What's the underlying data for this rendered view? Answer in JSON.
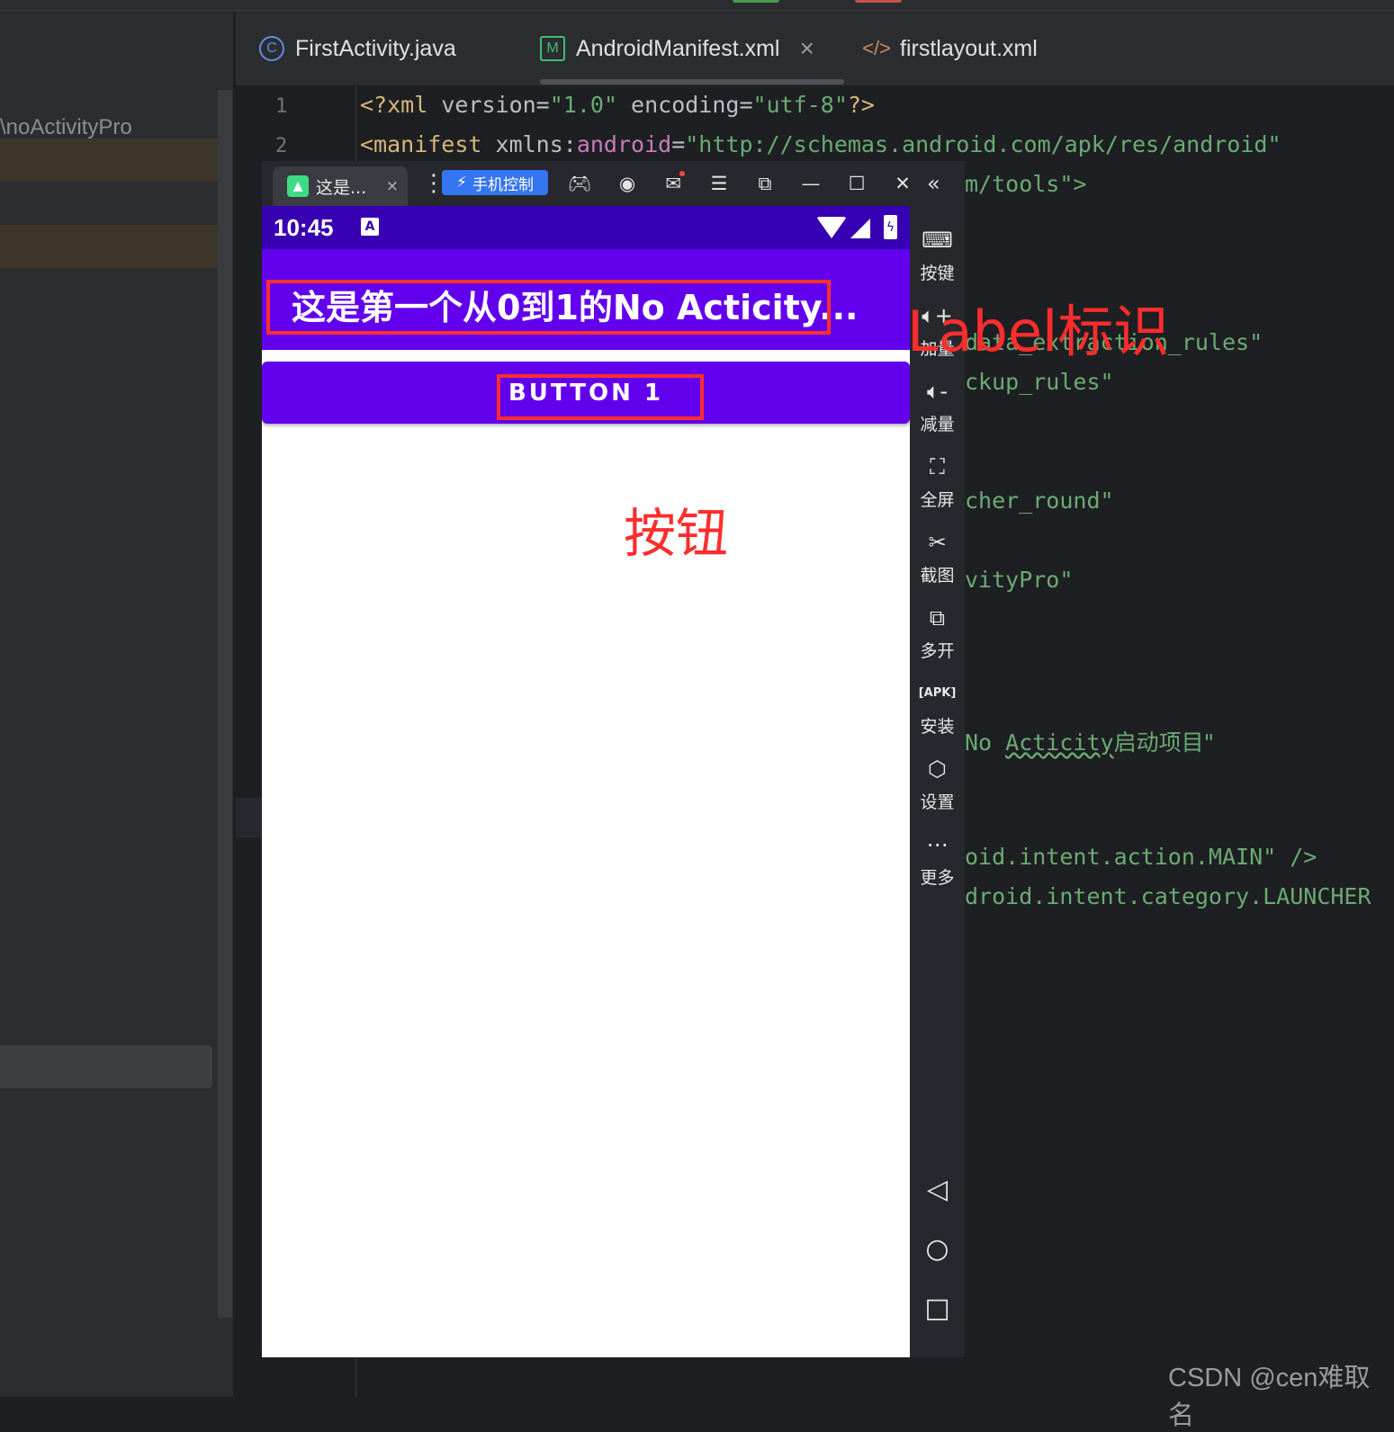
{
  "ide": {
    "project_path": "\\noActivityPro",
    "tabs": [
      {
        "label": "FirstActivity.java",
        "icon": "class-icon"
      },
      {
        "label": "AndroidManifest.xml",
        "icon": "manifest-icon",
        "active": true
      },
      {
        "label": "firstlayout.xml",
        "icon": "xml-icon"
      }
    ],
    "tab_close": "×",
    "line_numbers": [
      "1",
      "2"
    ],
    "code": {
      "line1": {
        "open": "<?xml ",
        "attr1": "version=",
        "val1": "\"1.0\" ",
        "attr2": "encoding=",
        "val2": "\"utf-8\"",
        "close": "?>"
      },
      "line2": {
        "tag": "<manifest ",
        "attr": "xmlns:",
        "ns": "android",
        "eq": "=",
        "val": "\"http://schemas.android.com/apk/res/android\""
      },
      "line3": "m/tools\">",
      "line4": "data_extraction_rules\"",
      "line5": "ckup_rules\"",
      "line6": "cher_round\"",
      "line7": "vityPro\"",
      "line8_pre": "No ",
      "line8_squiggle": "Acticity",
      "line8_post": "启动项目\"",
      "line9": "oid.intent.action.MAIN\" />",
      "line10": "droid.intent.category.LAUNCHER"
    },
    "colors": {
      "background": "#1e1f22",
      "tag": "#d5b778",
      "string": "#6aab73",
      "namespace": "#c77dbb"
    }
  },
  "emulator": {
    "tab_label": "这是...",
    "tab_close": "×",
    "phone_control_label": "手机控制",
    "toolbar_icons": [
      "gamepad-icon",
      "account-icon",
      "mail-icon",
      "menu-icon",
      "pin-window-icon",
      "minimize-icon",
      "maximize-icon",
      "close-icon",
      "collapse-icon"
    ],
    "sidebar_tools": [
      {
        "label": "按键",
        "icon": "keyboard-icon"
      },
      {
        "label": "加量",
        "icon": "volume-up-icon"
      },
      {
        "label": "减量",
        "icon": "volume-down-icon"
      },
      {
        "label": "全屏",
        "icon": "fullscreen-icon"
      },
      {
        "label": "截图",
        "icon": "scissors-icon"
      },
      {
        "label": "多开",
        "icon": "multi-instance-icon"
      },
      {
        "label": "安装",
        "icon": "apk-install-icon"
      },
      {
        "label": "设置",
        "icon": "settings-icon"
      },
      {
        "label": "更多",
        "icon": "more-icon"
      }
    ],
    "nav_buttons": [
      "back-icon",
      "home-icon",
      "recents-icon"
    ],
    "colors": {
      "status_bar": "#3700b3",
      "primary": "#6200ee"
    }
  },
  "phone": {
    "status_time": "10:45",
    "app_title": "这是第一个从0到1的No Acticity...",
    "button_label": "BUTTON 1"
  },
  "annotations": {
    "title_label": "Label标识",
    "button_label": "按钮",
    "color": "#ff2d2d"
  },
  "watermark": "CSDN @cen难取名"
}
